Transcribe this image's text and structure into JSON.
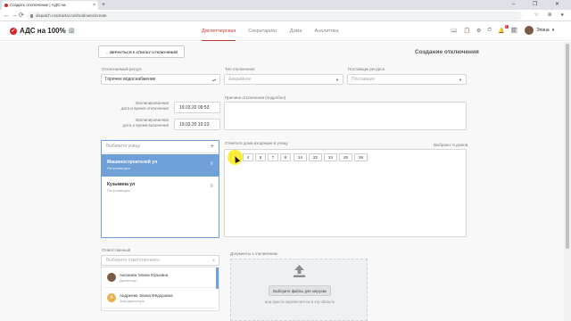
{
  "browser": {
    "tab_title": "Создать отключение | АДС на",
    "tab_close": "×",
    "new_tab": "+",
    "window_controls": "– ❐ ✕",
    "url": "dispatch.rosdcartal.ru/shutdowns/create",
    "nav": {
      "back": "←",
      "forward": "→",
      "reload": "⟳"
    }
  },
  "app": {
    "logo_text": "АДС на 100%",
    "logo_mark": "✓",
    "building_icon": "🏢",
    "nav": [
      "Диспетчерская",
      "Секретариат",
      "Дома",
      "Аналитика"
    ],
    "active_nav": "Диспетчерская",
    "notifications_count": "1",
    "user_name": "Элина",
    "icons": [
      "📖",
      "📋",
      "⚙",
      "⏱",
      "🔔",
      "🗓"
    ],
    "accent_color": "#c0392b"
  },
  "page": {
    "back_button": "← ВЕРНУТЬСЯ К СПИСКУ ОТКЛЮЧЕНИЙ",
    "title": "Создание отключения",
    "resource": {
      "label": "Отключаемый ресурс",
      "value": "Горячее водоснабжение"
    },
    "shutdown_type": {
      "label": "Тип отключения",
      "placeholder": "Аварийное"
    },
    "supplier": {
      "label": "Поставщик ресурса",
      "placeholder": "Поставщик"
    },
    "planned_start": {
      "label_line1": "Запланированная",
      "label_line2": "дата и время отключения",
      "value": "19.03.20 09:53"
    },
    "planned_end": {
      "label_line1": "Запланированная",
      "label_line2": "дата и время включения",
      "value": "19.03.20 10:23"
    },
    "reason": {
      "label": "Причина отключения (подробно)"
    },
    "streets": {
      "search_placeholder": "Выберите улицу",
      "add_icon": "+",
      "items": [
        {
          "name": "Машиностроителей ул",
          "district": "Петрозаводск"
        },
        {
          "name": "Кузьмина ул",
          "district": "Петрозаводск"
        }
      ],
      "menu_icon": "≡"
    },
    "houses": {
      "label": "Отметьте дома входящие в улицу",
      "selected_text": "Выбрано: 0 домов",
      "numbers": [
        "3",
        "4",
        "5",
        "7",
        "8",
        "14",
        "22",
        "24",
        "25",
        "26"
      ]
    },
    "responsible": {
      "label": "Ответственный",
      "search_placeholder": "Выберите ответственного",
      "people": [
        {
          "name": "Аксакова Элина Юрьевна",
          "role": "Диспетчер",
          "avatar_color": "#7a5a44",
          "initial": ""
        },
        {
          "name": "Андреева Элина Фёдоровна",
          "role": "Зам.директора",
          "avatar_color": "#e8b24b",
          "initial": "А"
        }
      ]
    },
    "documents": {
      "label": "Документы к отключению",
      "button": "Выберите файлы для загрузки",
      "hint": "или просто перенесите их в эту область"
    }
  }
}
